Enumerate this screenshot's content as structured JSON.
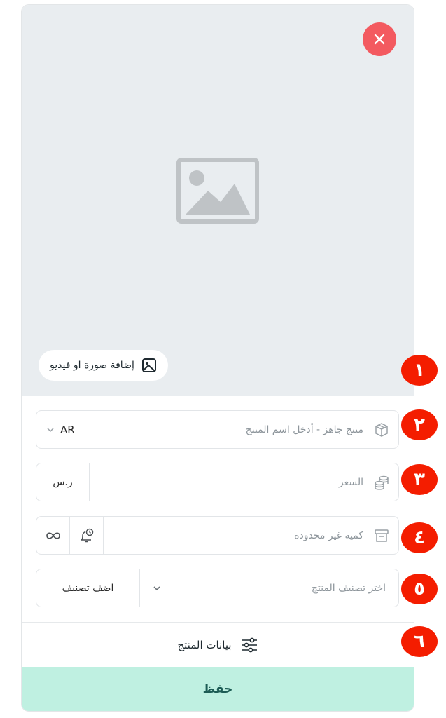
{
  "media": {
    "add_label": "إضافة صورة او فيديو"
  },
  "name_field": {
    "placeholder": "منتج جاهز - أدخل اسم المنتج",
    "language": "AR"
  },
  "price_field": {
    "placeholder": "السعر",
    "currency": "ر.س"
  },
  "quantity_field": {
    "placeholder": "كمية غير محدودة"
  },
  "category_field": {
    "placeholder": "اختر تصنيف المنتج",
    "add_button": "اضف تصنيف"
  },
  "product_data": {
    "label": "بيانات المنتج"
  },
  "save": {
    "label": "حفظ"
  },
  "annotations": [
    "١",
    "٢",
    "٣",
    "٤",
    "٥",
    "٦"
  ],
  "colors": {
    "close": "#f35a60",
    "badge": "#f41d00",
    "save_bg": "#bff0e1",
    "save_text": "#1d5c55",
    "media_bg": "#e9edf0"
  }
}
